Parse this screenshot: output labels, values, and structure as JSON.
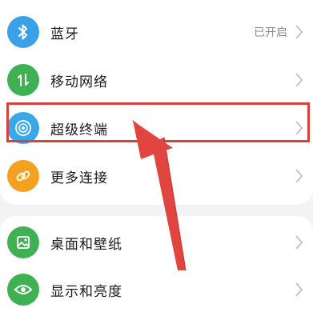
{
  "settings": {
    "items": [
      {
        "label": "蓝牙",
        "value": "已开启",
        "icon": "bluetooth-icon",
        "icon_color": "#3aa0e8"
      },
      {
        "label": "移动网络",
        "icon": "mobile-network-icon",
        "icon_color": "#3fb152"
      },
      {
        "label": "超级终端",
        "icon": "super-device-icon",
        "icon_color": "#3aa8e8"
      },
      {
        "label": "更多连接",
        "icon": "link-icon",
        "icon_color": "#f4a020"
      },
      {
        "label": "桌面和壁纸",
        "icon": "wallpaper-icon",
        "icon_color": "#3fb152"
      },
      {
        "label": "显示和亮度",
        "icon": "eye-icon",
        "icon_color": "#3fb152"
      }
    ]
  },
  "annotation": {
    "highlight_color": "#d9403b",
    "arrow_color": "#e0453f"
  }
}
